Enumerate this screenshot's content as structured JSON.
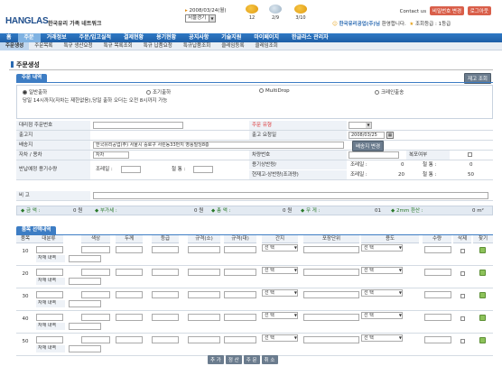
{
  "header": {
    "logo": "HANGLAS",
    "logo_sub": "한국유리 가족 네트워크",
    "date": "2008/03/24(월)",
    "region": "서울경기",
    "weather": [
      {
        "label": "12",
        "icon": "sun-icon"
      },
      {
        "label": "2/9",
        "icon": "cloud-icon"
      },
      {
        "label": "3/10",
        "icon": "sun-icon"
      }
    ],
    "contact": "Contact us",
    "btn_pw": "비밀번호 변경",
    "btn_logout": "로그아웃",
    "welcome_company": "한국유리공업(주)님",
    "welcome_text": " 환영합니다.",
    "grade_label": "조회등급 : ",
    "grade_value": "1등급"
  },
  "nav1": [
    "홈",
    "주문",
    "거래정보",
    "주문/입고실적",
    "결제현황",
    "용기현황",
    "공지사항",
    "기술지원",
    "마이페이지",
    "한글라스 관리자"
  ],
  "nav2": [
    "주문생성",
    "주문목록",
    "특규 생산요청",
    "특규 목록조회",
    "특규 납품요청",
    "특규납품조회",
    "클레임등록",
    "클레임조회"
  ],
  "page_title": "주문생성",
  "section1": {
    "tab": "주문 내역",
    "btn": "재고 조회",
    "radios": [
      "일반출하",
      "조기출하",
      "MultiDrop",
      "크레인출송"
    ],
    "notice": "당일 14시까지(자차는 제한없음),당일 출하 오더는 오전 8시까지 가능"
  },
  "form": {
    "l_order": "대리점 주문번호",
    "l_type": "주문 유형",
    "l_factory": "출고지",
    "l_reqdate": "출고 요청일",
    "v_reqdate": "2008/03/25",
    "l_dest": "배송지",
    "v_dest": "한국유리공업(주) 서울시 중로구 서린동33번지 영풍빌딩8층",
    "btn_newdest": "배송지 변경",
    "l_car": "자차 / 용차",
    "v_car": "자차",
    "l_carno": "차량번호",
    "l_ret": "복포여부",
    "l_shelf": "반납예정 용기수량",
    "l_crane": "조레일 :",
    "l_iron": "철 통 :",
    "l_cur": "용기상반량/",
    "l_cur2": "현재고-상반량(조과량)",
    "v_crane1": "0",
    "v_iron1": "0",
    "v_crane2": "20",
    "v_iron2": "50",
    "l_note": "비 고"
  },
  "summary": {
    "amount": "◆ 금 액 :",
    "amount_v": "0 원",
    "vat": "◆ 부가세 :",
    "vat_v": "0 원",
    "total": "◆ 총 액 :",
    "total_v": "0 원",
    "weight": "◆ 무 게 :",
    "weight_v": "01",
    "area": "◆ 2mm 환산 :",
    "area_v": "0 m²"
  },
  "section2": {
    "tab": "품목 선택내역",
    "headers": [
      "품목",
      "대분류",
      "색상",
      "두께",
      "등급",
      "규격(소)",
      "규격(대)",
      "간지",
      "포장단위",
      "용도",
      "수량",
      "삭제",
      "찾기"
    ],
    "rows": [
      "10",
      "20",
      "30",
      "40",
      "50"
    ],
    "detail": "자재 내역",
    "sel_pick": "선 택"
  },
  "bottom": [
    "추 가",
    "정 산",
    "주 문",
    "취 소"
  ]
}
